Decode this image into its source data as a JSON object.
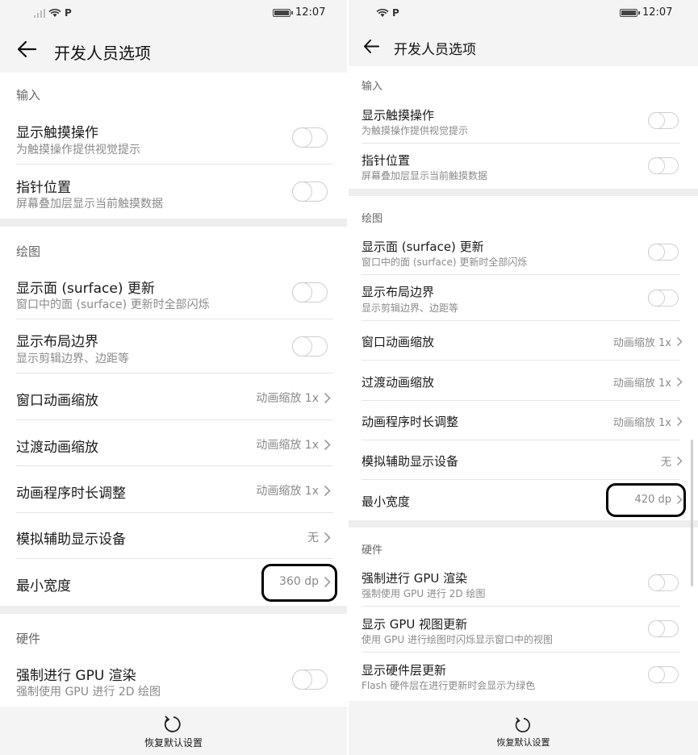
{
  "status": {
    "time": "12:07"
  },
  "appbar": {
    "title": "开发人员选项"
  },
  "sections": {
    "input": "输入",
    "drawing": "绘图",
    "hardware": "硬件"
  },
  "settings": {
    "show_touches": {
      "title": "显示触摸操作",
      "subtitle": "为触摸操作提供视觉提示"
    },
    "pointer_location": {
      "title": "指针位置",
      "subtitle": "屏幕叠加层显示当前触摸数据"
    },
    "surface_updates": {
      "title": "显示面 (surface) 更新",
      "subtitle": "窗口中的面 (surface) 更新时全部闪烁"
    },
    "layout_bounds": {
      "title": "显示布局边界",
      "subtitle": "显示剪辑边界、边距等"
    },
    "window_anim": {
      "title": "窗口动画缩放",
      "value": "动画缩放 1x"
    },
    "transition_anim": {
      "title": "过渡动画缩放",
      "value": "动画缩放 1x"
    },
    "animator_duration": {
      "title": "动画程序时长调整",
      "value": "动画缩放 1x"
    },
    "simulate_display": {
      "title": "模拟辅助显示设备",
      "value": "无"
    },
    "smallest_width": {
      "title": "最小宽度"
    },
    "force_gpu": {
      "title": "强制进行 GPU 渲染",
      "subtitle": "强制使用 GPU 进行 2D 绘图"
    },
    "gpu_view_updates": {
      "title": "显示 GPU 视图更新",
      "subtitle": "使用 GPU 进行绘图时闪烁显示窗口中的视图"
    },
    "hw_layer_updates": {
      "title": "显示硬件层更新",
      "subtitle": "Flash 硬件层在进行更新时会显示为绿色"
    }
  },
  "left_screen": {
    "smallest_width_value": "360 dp"
  },
  "right_screen": {
    "smallest_width_value": "420 dp"
  },
  "bottom": {
    "reset_label": "恢复默认设置"
  },
  "icons": {
    "back": "arrow-left-icon",
    "chevron": "chevron-right-icon",
    "reset": "refresh-icon",
    "wifi": "wifi-icon",
    "signal": "signal-icon",
    "battery": "battery-icon"
  }
}
